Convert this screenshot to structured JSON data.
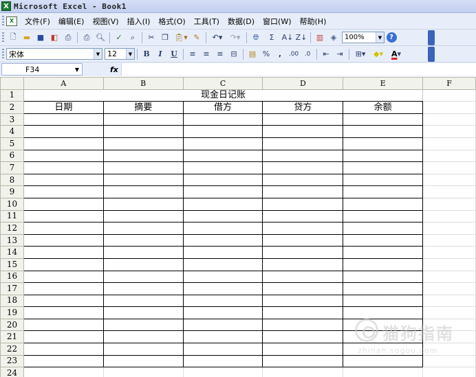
{
  "window": {
    "title": "Microsoft Excel - Book1",
    "app_icon": "excel-icon"
  },
  "menu": [
    "文件(F)",
    "编辑(E)",
    "视图(V)",
    "插入(I)",
    "格式(O)",
    "工具(T)",
    "数据(D)",
    "窗口(W)",
    "帮助(H)"
  ],
  "toolbar": {
    "zoom": "100%",
    "font_name": "宋体",
    "font_size": "12",
    "bold": "B",
    "italic": "I",
    "underline": "U",
    "percent": "%",
    "comma": ",",
    "sigma": "Σ",
    "font_color_label": "A"
  },
  "formula_bar": {
    "cell_ref": "F34",
    "fx": "fx",
    "content": ""
  },
  "sheet": {
    "columns": [
      "A",
      "B",
      "C",
      "D",
      "E",
      "F"
    ],
    "rows": [
      "1",
      "2",
      "3",
      "4",
      "5",
      "6",
      "7",
      "8",
      "9",
      "10",
      "11",
      "12",
      "13",
      "14",
      "15",
      "16",
      "17",
      "18",
      "19",
      "20",
      "21",
      "22",
      "23",
      "24"
    ],
    "title": "现金日记账",
    "headers": [
      "日期",
      "摘要",
      "借方",
      "贷方",
      "余额"
    ]
  },
  "watermark": {
    "text": "猫狗指南",
    "sub": "zhinan.sogou.com"
  }
}
